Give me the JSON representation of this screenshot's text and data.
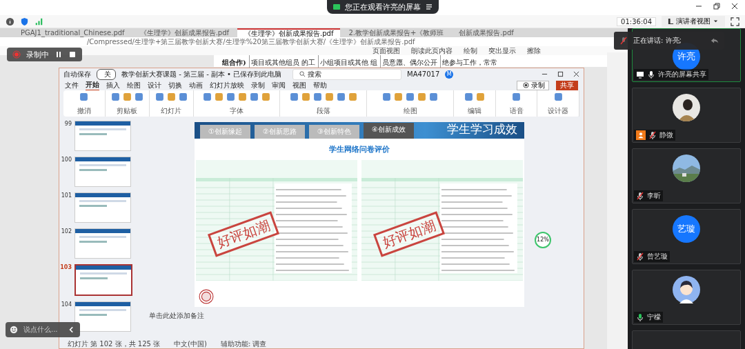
{
  "banner": {
    "text": "您正在观看许亮的屏幕"
  },
  "meeting_toolbar": {
    "timer": "01:36:04",
    "view_button": "演讲者视图"
  },
  "recording": {
    "label": "录制中"
  },
  "speaking": {
    "label": "正在讲话: 许亮;"
  },
  "browser": {
    "tabs": [
      {
        "label": "PGAJ1_traditional_Chinese.pdf",
        "selected": false
      },
      {
        "label": "《生理学》创新成果报告.pdf",
        "selected": false
      },
      {
        "label": "《生理学》创新成果报告.pdf",
        "selected": true
      },
      {
        "label": "2.教学创新成果报告+《教师班",
        "selected": false
      },
      {
        "label": "创新成果报告.pdf",
        "selected": false
      }
    ],
    "address": "/Compressed/生理学+第三届教学创新大赛/生理学%20第三届教学创新大赛/《生理学》创新成果报告.pdf",
    "pdf_tools": [
      "页面视图",
      "朗读此页内容",
      "绘制",
      "突出显示",
      "擦除"
    ],
    "pdf_cells": [
      "组合作)",
      "项目或其他组员 的工",
      "小组项目或其他 组",
      "员意愿、偶尔公开",
      "绝参与工作，常常"
    ]
  },
  "ppt": {
    "autosave": "自动保存",
    "autosave_on": false,
    "toggle_label": "关",
    "title": "教学创新大赛课题 - 第三届 - 副本 • 已保存到此电脑",
    "search": "搜索",
    "user": "MA47017",
    "avatar": "M",
    "record_button": "录制",
    "share_button": "共享",
    "menu": [
      {
        "label": "文件",
        "selected": false
      },
      {
        "label": "开始",
        "selected": true
      },
      {
        "label": "插入",
        "selected": false
      },
      {
        "label": "绘图",
        "selected": false
      },
      {
        "label": "设计",
        "selected": false
      },
      {
        "label": "切换",
        "selected": false
      },
      {
        "label": "动画",
        "selected": false
      },
      {
        "label": "幻灯片放映",
        "selected": false
      },
      {
        "label": "录制",
        "selected": false
      },
      {
        "label": "审阅",
        "selected": false
      },
      {
        "label": "视图",
        "selected": false
      },
      {
        "label": "帮助",
        "selected": false
      }
    ],
    "ribbon_groups": [
      "撤消",
      "剪贴板",
      "幻灯片",
      "字体",
      "段落",
      "绘图",
      "编辑",
      "语音",
      "设计器"
    ],
    "thumbnails": [
      {
        "number": "99",
        "selected": false
      },
      {
        "number": "100",
        "selected": false
      },
      {
        "number": "101",
        "selected": false
      },
      {
        "number": "102",
        "selected": false
      },
      {
        "number": "103",
        "selected": true
      },
      {
        "number": "104",
        "selected": false
      }
    ],
    "slide": {
      "tabs": [
        {
          "label": "①创新缘起",
          "selected": false
        },
        {
          "label": "②创新思路",
          "selected": false
        },
        {
          "label": "③创新特色",
          "selected": false
        },
        {
          "label": "④创新成效",
          "selected": true
        }
      ],
      "heading": "学生学习成效",
      "subtitle": "学生网络问卷评价",
      "stamps": [
        "好评如潮",
        "好评如潮"
      ]
    },
    "notes": "单击此处添加备注",
    "status": [
      "幻灯片 第 102 张，共 125 张",
      "中文(中国)",
      "辅助功能: 调查"
    ]
  },
  "zoom_badge": "12%",
  "chat": {
    "placeholder": "说点什么..."
  },
  "participants": [
    {
      "name": "许亮的屏幕共享",
      "avatar": "许亮",
      "kind": "screen",
      "muted": false,
      "host": false
    },
    {
      "name": "静微",
      "muted": true,
      "host": true
    },
    {
      "name": "李昕",
      "kind": "landscape",
      "muted": true,
      "host": false
    },
    {
      "name": "曾艺璇",
      "avatar": "艺璇",
      "kind": "initials",
      "muted": true,
      "host": false
    },
    {
      "name": "宁檬",
      "kind": "cartoon",
      "muted": false,
      "host": false
    }
  ]
}
